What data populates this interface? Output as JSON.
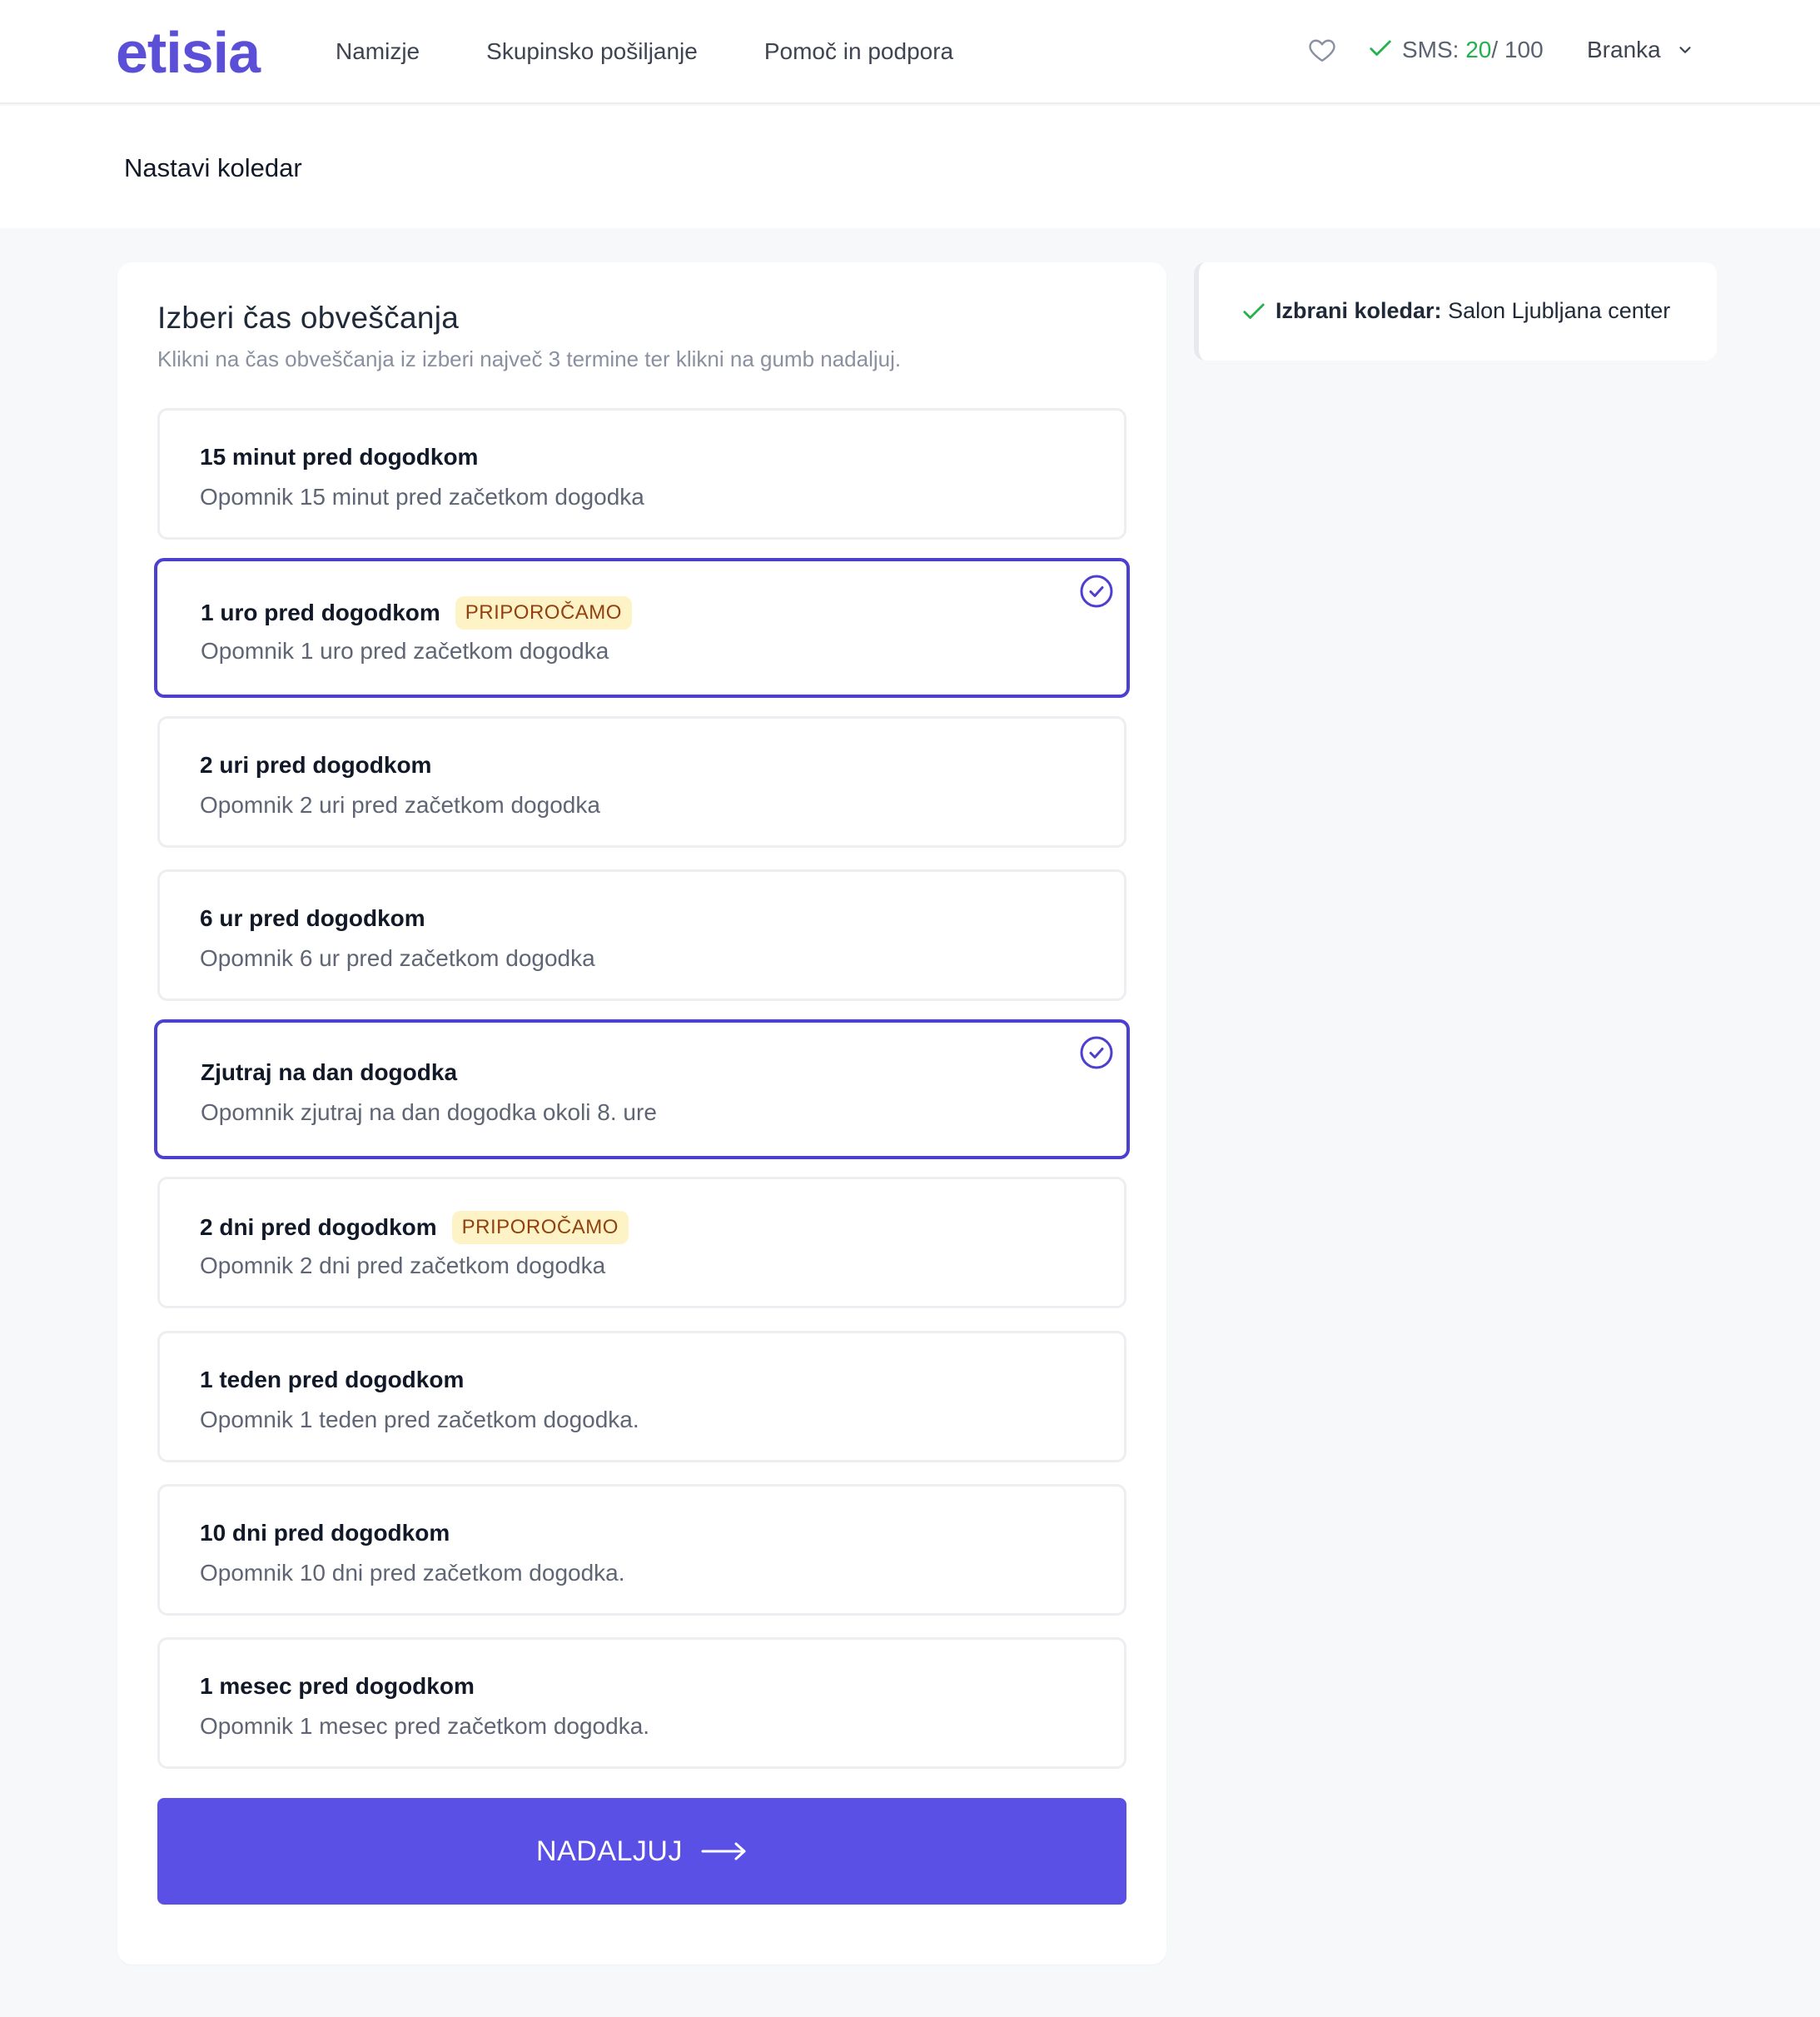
{
  "header": {
    "logo": "etisia",
    "nav": [
      "Namizje",
      "Skupinsko pošiljanje",
      "Pomoč in podpora"
    ],
    "sms_label": "SMS: ",
    "sms_used": "20",
    "sms_total": "/ 100",
    "user_name": "Branka",
    "icons": {
      "favorite": "heart-icon",
      "sms_status": "check-icon",
      "user_menu": "chevron-down-icon"
    }
  },
  "page": {
    "title": "Nastavi koledar"
  },
  "form": {
    "title": "Izberi čas obveščanja",
    "subtitle": "Klikni na čas obveščanja iz izberi največ 3 termine ter klikni na gumb nadaljuj.",
    "options": [
      {
        "title": "15 minut pred dogodkom",
        "description": "Opomnik 15 minut pred začetkom dogodka",
        "badge": "",
        "selected": false
      },
      {
        "title": "1 uro pred dogodkom",
        "description": "Opomnik 1 uro pred začetkom dogodka",
        "badge": "PRIPOROČAMO",
        "selected": true
      },
      {
        "title": "2 uri pred dogodkom",
        "description": "Opomnik 2 uri pred začetkom dogodka",
        "badge": "",
        "selected": false
      },
      {
        "title": "6 ur pred dogodkom",
        "description": "Opomnik 6 ur pred začetkom dogodka",
        "badge": "",
        "selected": false
      },
      {
        "title": "Zjutraj na dan dogodka",
        "description": "Opomnik zjutraj na dan dogodka okoli 8. ure",
        "badge": "",
        "selected": true
      },
      {
        "title": "2 dni pred dogodkom",
        "description": "Opomnik 2 dni pred začetkom dogodka",
        "badge": "PRIPOROČAMO",
        "selected": false
      },
      {
        "title": "1 teden pred dogodkom",
        "description": "Opomnik 1 teden pred začetkom dogodka.",
        "badge": "",
        "selected": false
      },
      {
        "title": "10 dni pred dogodkom",
        "description": "Opomnik 10 dni pred začetkom dogodka.",
        "badge": "",
        "selected": false
      },
      {
        "title": "1 mesec pred dogodkom",
        "description": "Opomnik 1 mesec pred začetkom dogodka.",
        "badge": "",
        "selected": false
      }
    ],
    "continue_label": "NADALJUJ"
  },
  "sidebar": {
    "selected_label": "Izbrani koledar:",
    "selected_value": "Salon Ljubljana center"
  },
  "colors": {
    "brand": "#5a4fd6",
    "button": "#5b50e6",
    "selected_border": "#4d3fd0",
    "success": "#22b14c",
    "badge_bg": "#fef3c7",
    "badge_text": "#92400e"
  }
}
